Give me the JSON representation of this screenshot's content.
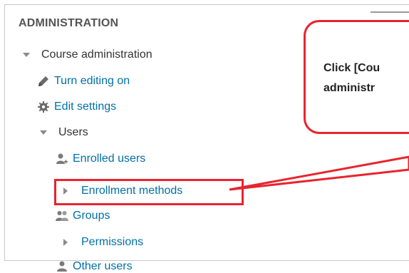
{
  "block": {
    "title": "ADMINISTRATION"
  },
  "tree": {
    "course_admin": "Course administration",
    "turn_editing": "Turn editing on",
    "edit_settings": "Edit settings",
    "users": "Users",
    "enrolled_users": "Enrolled users",
    "enrollment_methods": "Enrollment methods",
    "groups": "Groups",
    "permissions": "Permissions",
    "other_users": "Other users"
  },
  "callout": {
    "line1": "Click [Cou",
    "line2": "administr"
  },
  "colors": {
    "link": "#0070a8",
    "highlight": "#e8242e",
    "icon": "#8a8a8a"
  },
  "icons": {
    "expanded": "triangle-down-icon",
    "collapsed": "triangle-right-icon",
    "edit": "pencil-icon",
    "settings": "gear-icon",
    "enrolled": "user-plus-icon",
    "groups": "users-icon",
    "other": "user-icon"
  }
}
